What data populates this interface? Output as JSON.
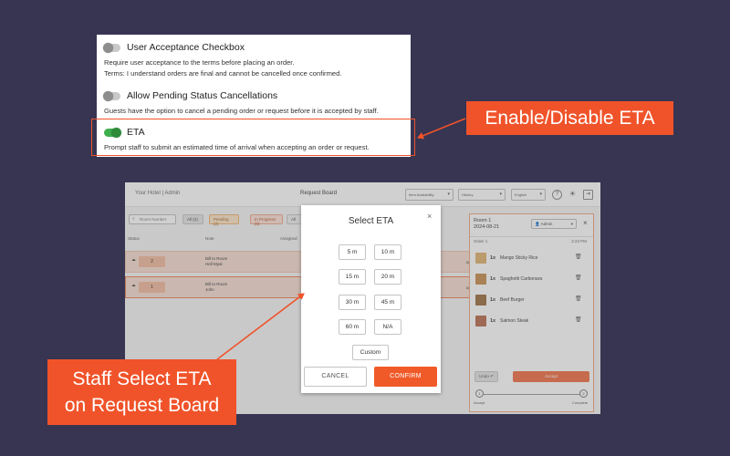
{
  "settings": {
    "items": [
      {
        "title": "User Acceptance Checkbox",
        "enabled": false,
        "desc_1": "Require user acceptance to the terms before placing an order.",
        "desc_2": "Terms: I understand orders are final and cannot be cancelled once confirmed."
      },
      {
        "title": "Allow Pending Status Cancellations",
        "enabled": false,
        "desc_1": "Guests have the option to cancel a pending order or request before it is accepted by staff."
      },
      {
        "title": "ETA",
        "enabled": true,
        "desc_1": "Prompt staff to submit an estimated time of arrival when accepting an order or request."
      }
    ]
  },
  "callouts": {
    "eta": "Enable/Disable ETA",
    "staff_line_1": "Staff Select ETA",
    "staff_line_2": "on Request Board"
  },
  "board": {
    "hotel": "Your Hotel | Admin",
    "title": "Request Board",
    "select_availability": "Item Availability",
    "select_history": "History",
    "select_language": "English",
    "search_placeholder": "Room Number",
    "chips": [
      "All (2)",
      "Pending (2)",
      "In Progress (0)",
      "All"
    ],
    "columns": [
      "Status",
      "Note",
      "Assigned"
    ],
    "rows": [
      {
        "number": "2",
        "note_1": "Bill to Room",
        "note_2": "Hell Myal",
        "tail": "ago"
      },
      {
        "number": "1",
        "note_1": "Bill to Room",
        "note_2": "John",
        "tail": "ago"
      }
    ],
    "panel": {
      "room": "Room 1",
      "date": "2024-08-21",
      "admin": "Admin",
      "order_label": "Order 1",
      "order_time": "2:23 PM",
      "items": [
        {
          "qty": "1x",
          "name": "Mango Sticky Rice"
        },
        {
          "qty": "1x",
          "name": "Spaghetti Carbonara"
        },
        {
          "qty": "1x",
          "name": "Beef Burger"
        },
        {
          "qty": "1x",
          "name": "Salmon Steak"
        }
      ],
      "undo": "Undo",
      "accept": "Accept",
      "step_1": "1",
      "step_2": "2",
      "step_1_label": "Accept",
      "step_2_label": "Complete"
    }
  },
  "modal": {
    "title": "Select ETA",
    "options": [
      "5 m",
      "10 m",
      "15 m",
      "20 m",
      "30 m",
      "45 m",
      "60 m",
      "N/A"
    ],
    "custom": "Custom",
    "cancel": "CANCEL",
    "confirm": "CONFIRM"
  },
  "colors": {
    "accent": "#f05a29",
    "toggle_on": "#3fae4c",
    "background": "#373552"
  }
}
